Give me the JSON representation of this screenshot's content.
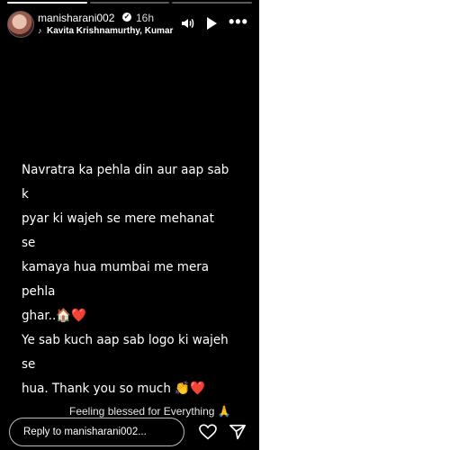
{
  "story": {
    "progress_segments": 3,
    "completed_segments": 1,
    "author": "manisharani002",
    "verified": true,
    "time_ago": "16h",
    "music": "Kavita Krishnamurthy, Kumar",
    "message_lines": [
      "Navratra ka pehla din aur aap sab k",
      "pyar ki wajeh se mere mehanat se",
      "kamaya hua mumbai me mera pehla",
      "ghar..🏠❤️",
      "Ye sab kuch aap sab logo ki wajeh se",
      "hua. Thank you so much 👏❤️"
    ],
    "caption": "Feeling blessed for Everything 🙏",
    "reply_placeholder": "Reply to manisharani002...",
    "icons": {
      "music": "music-note-icon",
      "speaker": "speaker-icon",
      "play": "play-icon",
      "more": "more-options-icon",
      "heart": "heart-icon",
      "send": "send-icon"
    }
  }
}
